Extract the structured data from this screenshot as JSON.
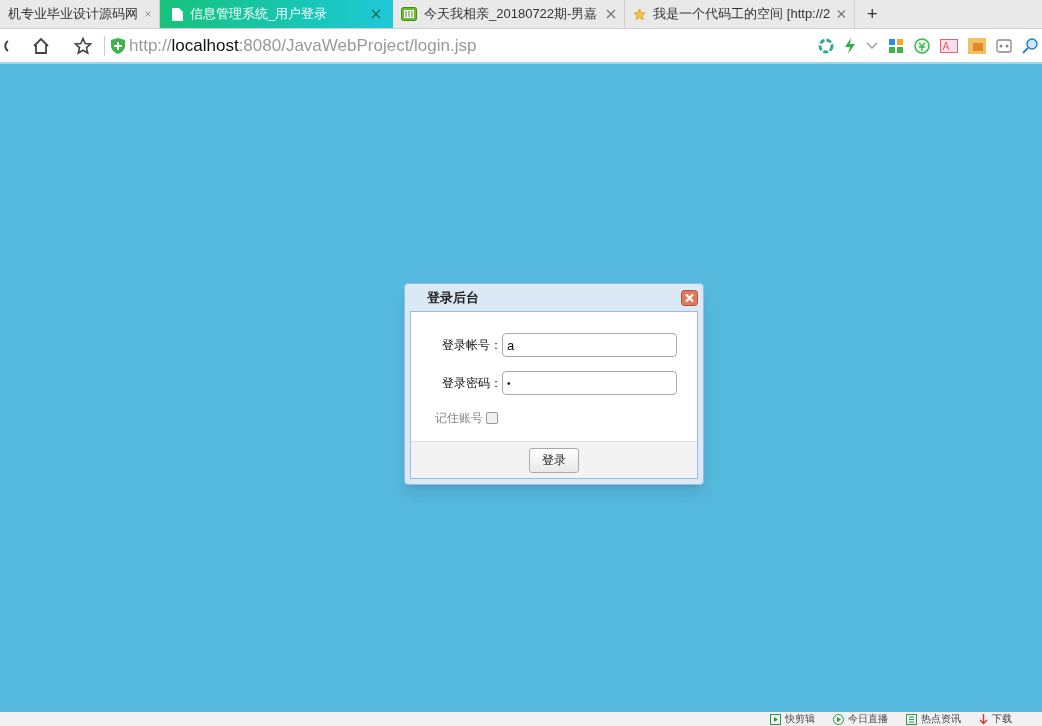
{
  "tabs": [
    {
      "label": "机专业毕业设计源码网",
      "selected": false,
      "kind": "plain"
    },
    {
      "label": "信息管理系统_用户登录",
      "selected": true,
      "kind": "page"
    },
    {
      "label": "今天我相亲_20180722期-男嘉",
      "selected": false,
      "kind": "video"
    },
    {
      "label": "我是一个代码工的空间 [http://2",
      "selected": false,
      "kind": "star"
    }
  ],
  "new_tab": "+",
  "address": {
    "scheme": "http://",
    "host": "localhost",
    "path": ":8080/JavaWebProject/login.jsp"
  },
  "dialog": {
    "title": "登录后台",
    "fields": [
      {
        "label": "登录帐号：",
        "value": "a",
        "kind": "text"
      },
      {
        "label": "登录密码：",
        "value": "•",
        "kind": "password"
      }
    ],
    "remember": {
      "label": "记住账号",
      "checked": false
    },
    "submit": "登录"
  },
  "status_bar": [
    {
      "label": "快剪辑",
      "kind": "clip"
    },
    {
      "label": "今日直播",
      "kind": "live"
    },
    {
      "label": "热点资讯",
      "kind": "news"
    },
    {
      "label": "下载",
      "kind": "download"
    }
  ]
}
